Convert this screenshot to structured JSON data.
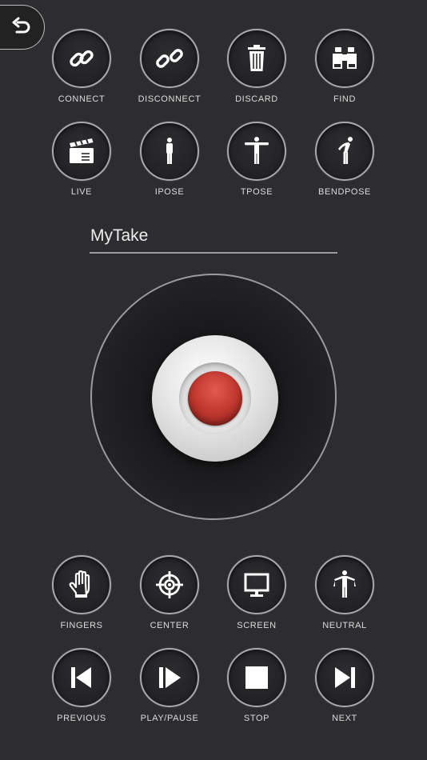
{
  "top_row_1": [
    {
      "label": "CONNECT",
      "icon": "link-icon"
    },
    {
      "label": "DISCONNECT",
      "icon": "broken-link-icon"
    },
    {
      "label": "DISCARD",
      "icon": "trash-icon"
    },
    {
      "label": "FIND",
      "icon": "binoculars-icon"
    }
  ],
  "top_row_2": [
    {
      "label": "LIVE",
      "icon": "clapperboard-icon"
    },
    {
      "label": "IPOSE",
      "icon": "i-pose-figure-icon"
    },
    {
      "label": "TPOSE",
      "icon": "t-pose-figure-icon"
    },
    {
      "label": "BENDPOSE",
      "icon": "bend-pose-figure-icon"
    }
  ],
  "take_name": "MyTake",
  "bottom_row_1": [
    {
      "label": "FINGERS",
      "icon": "hand-icon"
    },
    {
      "label": "CENTER",
      "icon": "crosshair-icon"
    },
    {
      "label": "SCREEN",
      "icon": "monitor-icon"
    },
    {
      "label": "NEUTRAL",
      "icon": "neutral-figure-icon"
    }
  ],
  "bottom_row_2": [
    {
      "label": "PREVIOUS",
      "icon": "skip-previous-icon"
    },
    {
      "label": "PLAY/PAUSE",
      "icon": "play-pause-icon"
    },
    {
      "label": "STOP",
      "icon": "stop-icon"
    },
    {
      "label": "NEXT",
      "icon": "skip-next-icon"
    }
  ],
  "colors": {
    "background": "#2d2d30",
    "record_red": "#c43b32",
    "ring_border": "#a9a9ad"
  }
}
